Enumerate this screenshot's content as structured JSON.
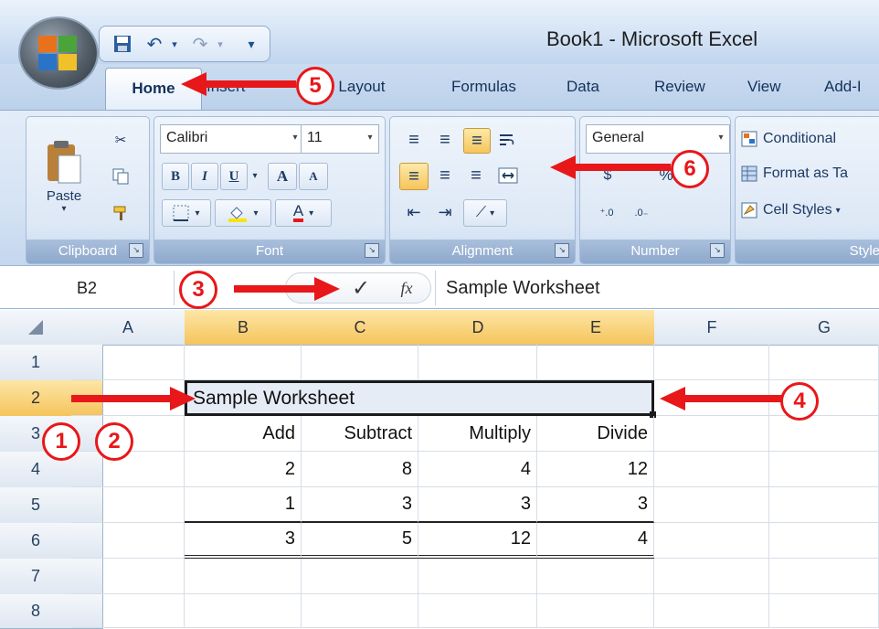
{
  "window": {
    "title": "Book1 - Microsoft Excel"
  },
  "tabs": [
    "Home",
    "Insert",
    "Page Layout",
    "Formulas",
    "Data",
    "Review",
    "View",
    "Add-I"
  ],
  "ribbon": {
    "clipboard": {
      "label": "Clipboard",
      "paste_label": "Paste"
    },
    "font": {
      "label": "Font",
      "font_name": "Calibri",
      "font_size": "11",
      "bold": "B",
      "italic": "I",
      "underline": "U",
      "grow": "A",
      "shrink": "A",
      "color_a": "A"
    },
    "alignment": {
      "label": "Alignment"
    },
    "number": {
      "label": "Number",
      "format": "General",
      "percent": "%"
    },
    "styles": {
      "label": "Style",
      "conditional": "Conditional",
      "format_table": "Format as Ta",
      "cell_styles": "Cell Styles"
    }
  },
  "formula_bar": {
    "name_box": "B2",
    "value": "Sample Worksheet",
    "fx": "fx",
    "check": "✓"
  },
  "grid": {
    "columns": [
      "A",
      "B",
      "C",
      "D",
      "E",
      "F",
      "G"
    ],
    "rows": [
      "1",
      "2",
      "3",
      "4",
      "5",
      "6",
      "7",
      "8"
    ],
    "title_cell": "Sample Worksheet",
    "headers": [
      "Add",
      "Subtract",
      "Multiply",
      "Divide"
    ],
    "data": [
      [
        "2",
        "8",
        "4",
        "12"
      ],
      [
        "1",
        "3",
        "3",
        "3"
      ],
      [
        "3",
        "5",
        "12",
        "4"
      ]
    ]
  },
  "annotations": {
    "c1": "1",
    "c2": "2",
    "c3": "3",
    "c4": "4",
    "c5": "5",
    "c6": "6"
  },
  "colors": {
    "arrow": "#e8171a",
    "selection": "#f5c45c"
  }
}
